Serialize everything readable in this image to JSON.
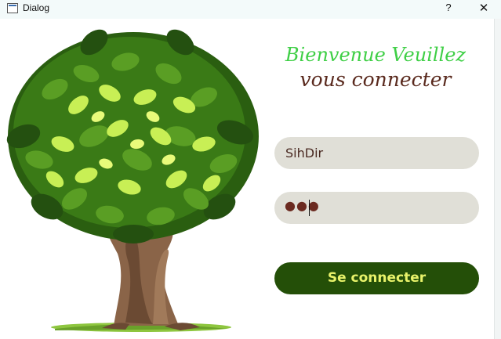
{
  "window": {
    "title": "Dialog",
    "help_label": "?",
    "close_label": "✕"
  },
  "welcome": {
    "line1": "Bienvenue Veuillez",
    "line2": "vous connecter"
  },
  "form": {
    "username_value": "SihDir",
    "password_masked": "●●●",
    "login_label": "Se connecter"
  },
  "colors": {
    "welcome_green": "#3fcf46",
    "welcome_brown": "#5a2a1e",
    "field_bg": "#e0dfd7",
    "button_bg": "#244f08",
    "button_text": "#e9f36a"
  },
  "icons": {
    "app": "window-icon",
    "help": "question-mark-icon",
    "close": "close-icon",
    "illustration": "tree-illustration"
  }
}
